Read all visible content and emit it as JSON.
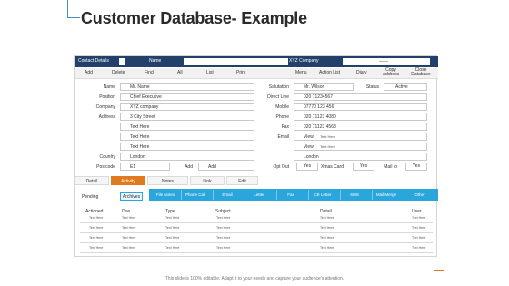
{
  "page": {
    "title": "Customer Database- Example",
    "footer": "This slide is 100% editable. Adapt it to your needs and capture your audience's attention."
  },
  "header": {
    "contact_details": "Contact Details",
    "name_label": "Name",
    "company": "XYZ Company",
    "right_pill": "——"
  },
  "menu": {
    "items": [
      "Add",
      "Delete",
      "Find",
      "All",
      "List",
      "Print",
      "Menu",
      "Action List",
      "Diary",
      "Copy Address",
      "Close Database"
    ]
  },
  "form_left": {
    "name_label": "Name",
    "name_value": "Mr. Name",
    "position_label": "Position",
    "position_value": "Chief Executive",
    "company_label": "Company",
    "company_value": "XYZ company",
    "address_label": "Address",
    "address_value": "3 City Street",
    "line2": "Text Here",
    "line3": "Text Here",
    "line4": "Text Here",
    "country_label": "Country",
    "country_value": "London",
    "postcode_label": "Postcode",
    "postcode_value": "E1",
    "add_label": "Add",
    "add_button": "Add"
  },
  "form_right": {
    "salutation_label": "Salutation",
    "salutation_value": "Mr. Wilson",
    "status_label": "Status",
    "status_value": "Active",
    "direct_label": "Direct Line",
    "direct_value": "020 71234567",
    "mobile_label": "Mobile",
    "mobile_value": "07770 123 456",
    "phone_label": "Phone",
    "phone_value": "020 71123 4080",
    "fax_label": "Fax",
    "fax_value": "020 71123 4568",
    "email_label": "Email",
    "view1": "View",
    "view1_text": "Text Here",
    "view2": "View",
    "view2_text": "Text Here",
    "city_value": "London",
    "optout_label": "Opt Out",
    "optout_yes": "Yes",
    "xmas_label": "Xmas Card",
    "xmas_yes": "Yes",
    "mailto_label": "Mail to",
    "mailto_yes": "Yes"
  },
  "tabs": [
    "Detail",
    "Activity",
    "Notes",
    "Link",
    "Edit"
  ],
  "actions": {
    "pending": "Pending",
    "archives": "Archives",
    "buttons": [
      "File Notes",
      "Phone Call",
      "Email",
      "Letter",
      "Fax",
      "CE Letter",
      "SMS",
      "Mail Merge",
      "Other"
    ]
  },
  "table": {
    "columns": [
      "Actioned",
      "Due",
      "Type",
      "Subject",
      "Detail",
      "User"
    ],
    "rows": [
      [
        "Text Here",
        "Text Here",
        "Text Here",
        "Text Here",
        "Text Here",
        "Text Here"
      ],
      [
        "Text Here",
        "Text Here",
        "Text Here",
        "Text Here",
        "Text Here",
        "Text Here"
      ],
      [
        "Text Here",
        "Text Here",
        "Text Here",
        "Text Here",
        "Text Here",
        "Text Here"
      ],
      [
        "Text Here",
        "Text Here",
        "Text Here",
        "Text Here",
        "Text Here",
        "Text Here"
      ]
    ]
  },
  "colors": {
    "header_bg": "#23406a",
    "accent_orange": "#e07a1f",
    "action_blue": "#2aa6dd",
    "corner_blue": "#4a8fbe"
  }
}
